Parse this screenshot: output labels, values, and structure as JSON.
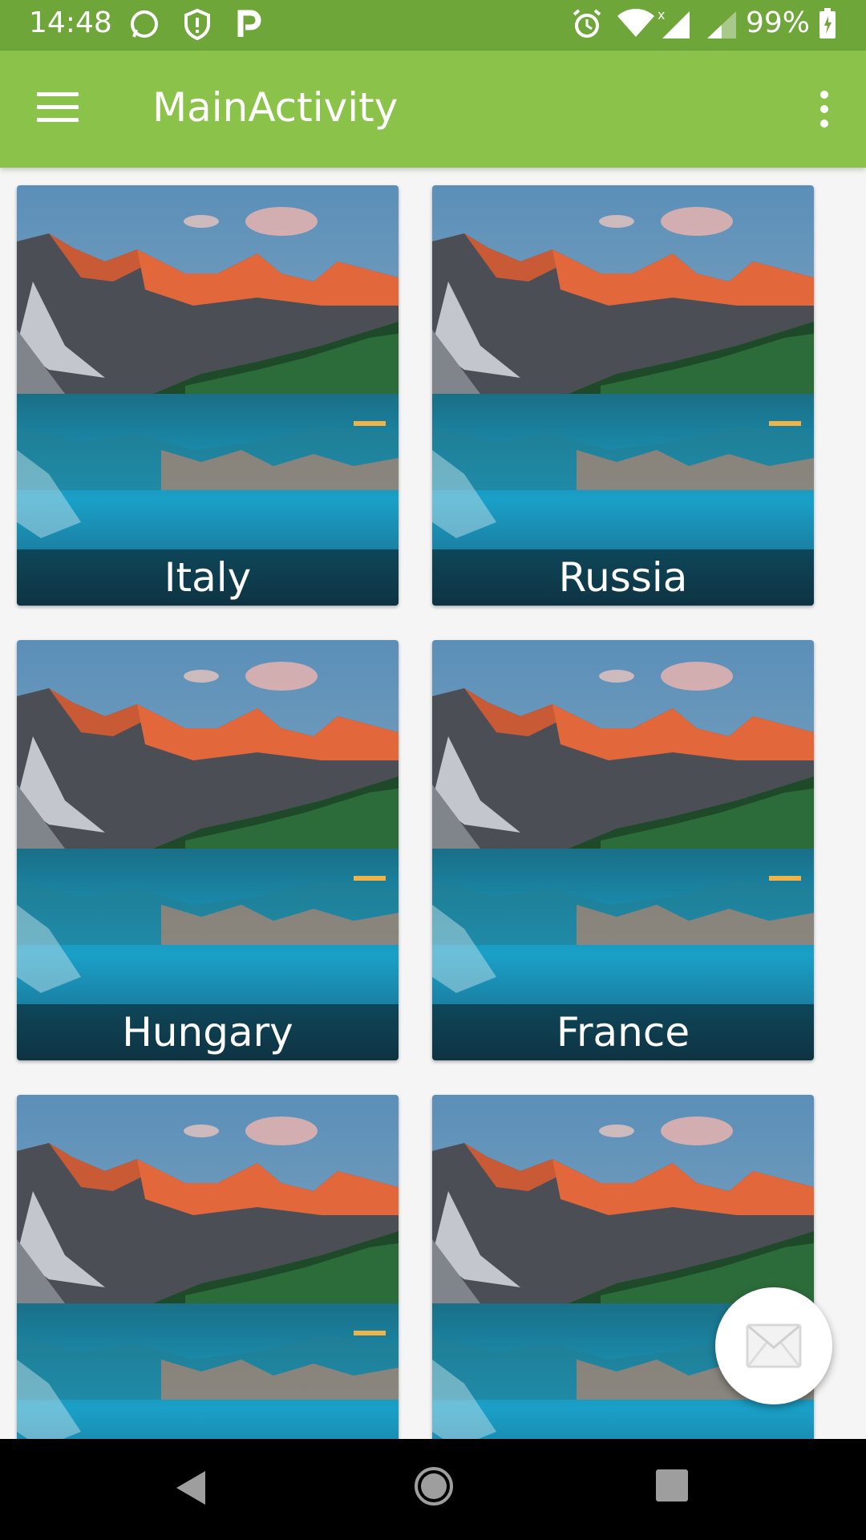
{
  "status_bar": {
    "time": "14:48",
    "battery": "99%",
    "icons": [
      "whatsapp-icon",
      "shield-icon",
      "parking-icon",
      "alarm-icon",
      "wifi-icon",
      "signal-icon",
      "signal-weak-icon",
      "battery-icon"
    ]
  },
  "app_bar": {
    "title": "MainActivity",
    "menu_icon": "hamburger-menu-icon",
    "overflow_icon": "more-vert-icon"
  },
  "cards": [
    {
      "label": "Italy"
    },
    {
      "label": "Russia"
    },
    {
      "label": "Hungary"
    },
    {
      "label": "France"
    },
    {
      "label": ""
    },
    {
      "label": ""
    }
  ],
  "fab": {
    "icon": "mail-icon"
  },
  "nav_bar": {
    "icons": [
      "back-icon",
      "home-icon",
      "recents-icon"
    ]
  },
  "colors": {
    "status_bar": "#6ea63a",
    "app_bar": "#8bc34a"
  }
}
